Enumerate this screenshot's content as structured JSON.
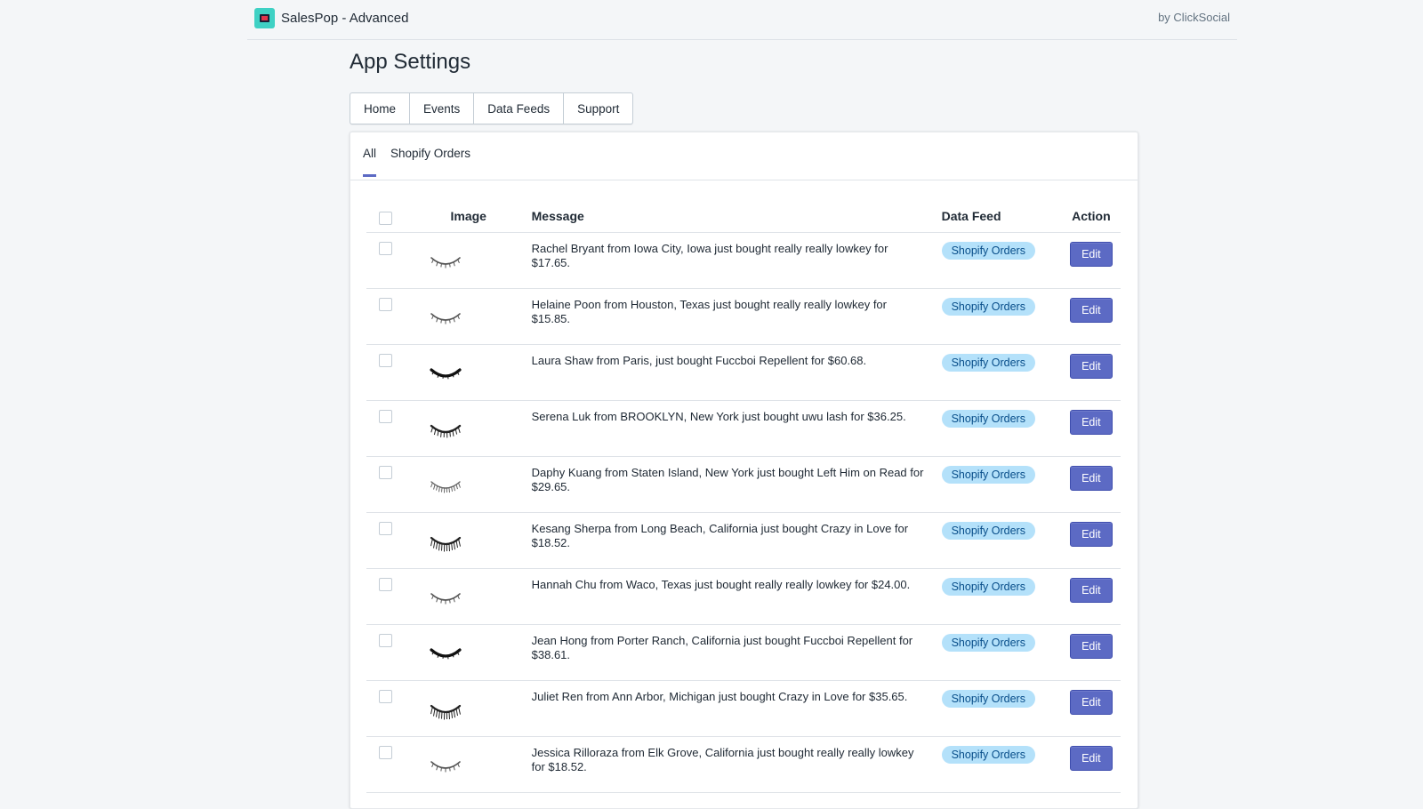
{
  "header": {
    "app_name": "SalesPop - Advanced",
    "byline": "by ClickSocial"
  },
  "page_title": "App Settings",
  "nav_tabs": [
    "Home",
    "Events",
    "Data Feeds",
    "Support"
  ],
  "sub_tabs": [
    "All",
    "Shopify Orders"
  ],
  "table": {
    "columns": {
      "image": "Image",
      "message": "Message",
      "data_feed": "Data Feed",
      "action": "Action"
    },
    "rows": [
      {
        "message": "Rachel Bryant from Iowa City, Iowa just bought really really lowkey for $17.65.",
        "feed": "Shopify Orders",
        "action": "Edit",
        "icon": "lash-thin"
      },
      {
        "message": "Helaine Poon from Houston, Texas just bought really really lowkey for $15.85.",
        "feed": "Shopify Orders",
        "action": "Edit",
        "icon": "lash-thin"
      },
      {
        "message": "Laura Shaw from Paris, just bought Fuccboi Repellent for $60.68.",
        "feed": "Shopify Orders",
        "action": "Edit",
        "icon": "lash-bold"
      },
      {
        "message": "Serena Luk from BROOKLYN, New York just bought uwu lash for $36.25.",
        "feed": "Shopify Orders",
        "action": "Edit",
        "icon": "lash-spiky"
      },
      {
        "message": "Daphy Kuang from Staten Island, New York just bought Left Him on Read for $29.65.",
        "feed": "Shopify Orders",
        "action": "Edit",
        "icon": "lash-feather"
      },
      {
        "message": "Kesang Sherpa from Long Beach, California just bought Crazy in Love for $18.52.",
        "feed": "Shopify Orders",
        "action": "Edit",
        "icon": "lash-dramatic"
      },
      {
        "message": "Hannah Chu from Waco, Texas just bought really really lowkey for $24.00.",
        "feed": "Shopify Orders",
        "action": "Edit",
        "icon": "lash-thin"
      },
      {
        "message": "Jean Hong from Porter Ranch, California just bought Fuccboi Repellent for $38.61.",
        "feed": "Shopify Orders",
        "action": "Edit",
        "icon": "lash-bold"
      },
      {
        "message": "Juliet Ren from Ann Arbor, Michigan just bought Crazy in Love for $35.65.",
        "feed": "Shopify Orders",
        "action": "Edit",
        "icon": "lash-dramatic"
      },
      {
        "message": "Jessica Rilloraza from Elk Grove, California just bought really really lowkey for $18.52.",
        "feed": "Shopify Orders",
        "action": "Edit",
        "icon": "lash-thin"
      }
    ]
  },
  "colors": {
    "accent": "#5c6ac4",
    "badge_bg": "#b4e1fa",
    "badge_text": "#084e8a",
    "background": "#f4f6f8"
  }
}
